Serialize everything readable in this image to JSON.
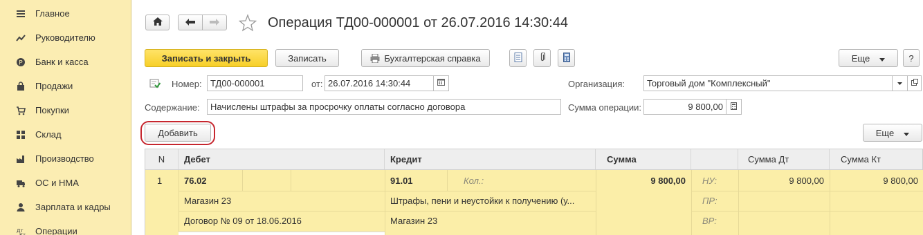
{
  "sidebar": {
    "items": [
      {
        "label": "Главное",
        "icon": "menu-lines-icon"
      },
      {
        "label": "Руководителю",
        "icon": "trend-chart-icon"
      },
      {
        "label": "Банк и касса",
        "icon": "coin-icon"
      },
      {
        "label": "Продажи",
        "icon": "shopping-bag-icon"
      },
      {
        "label": "Покупки",
        "icon": "shopping-cart-icon"
      },
      {
        "label": "Склад",
        "icon": "warehouse-grid-icon"
      },
      {
        "label": "Производство",
        "icon": "factory-icon"
      },
      {
        "label": "ОС и НМА",
        "icon": "truck-icon"
      },
      {
        "label": "Зарплата и кадры",
        "icon": "person-icon"
      },
      {
        "label": "Операции",
        "icon": "dt-kt-icon"
      }
    ]
  },
  "header": {
    "title": "Операция ТД00-000001 от 26.07.2016 14:30:44"
  },
  "toolbar": {
    "save_close_label": "Записать и закрыть",
    "save_label": "Записать",
    "report_label": "Бухгалтерская справка",
    "more_label": "Еще",
    "help_label": "?"
  },
  "form": {
    "number_label": "Номер:",
    "number_value": "ТД00-000001",
    "date_label": "от:",
    "date_value": "26.07.2016 14:30:44",
    "org_label": "Организация:",
    "org_value": "Торговый дом \"Комплексный\"",
    "content_label": "Содержание:",
    "content_value": "Начислены штрафы за просрочку оплаты согласно договора",
    "amount_label": "Сумма операции:",
    "amount_value": "9 800,00"
  },
  "table_toolbar": {
    "add_label": "Добавить",
    "more_label": "Еще"
  },
  "table": {
    "headers": {
      "n": "N",
      "debit": "Дебет",
      "credit": "Кредит",
      "sum": "Сумма",
      "sum_dt": "Сумма Дт",
      "sum_kt": "Сумма Кт"
    },
    "row": {
      "n": "1",
      "debit_account": "76.02",
      "debit_sub1": "Магазин 23",
      "debit_sub2": "Договор № 09 от 18.06.2016",
      "credit_account": "91.01",
      "credit_qty_label": "Кол.:",
      "credit_sub1": "Штрафы, пени и неустойки к получению (у...",
      "credit_sub2": "Магазин 23",
      "sum": "9 800,00",
      "nu_label": "НУ:",
      "pr_label": "ПР:",
      "vr_label": "ВР:",
      "sum_dt": "9 800,00",
      "sum_kt": "9 800,00"
    }
  }
}
